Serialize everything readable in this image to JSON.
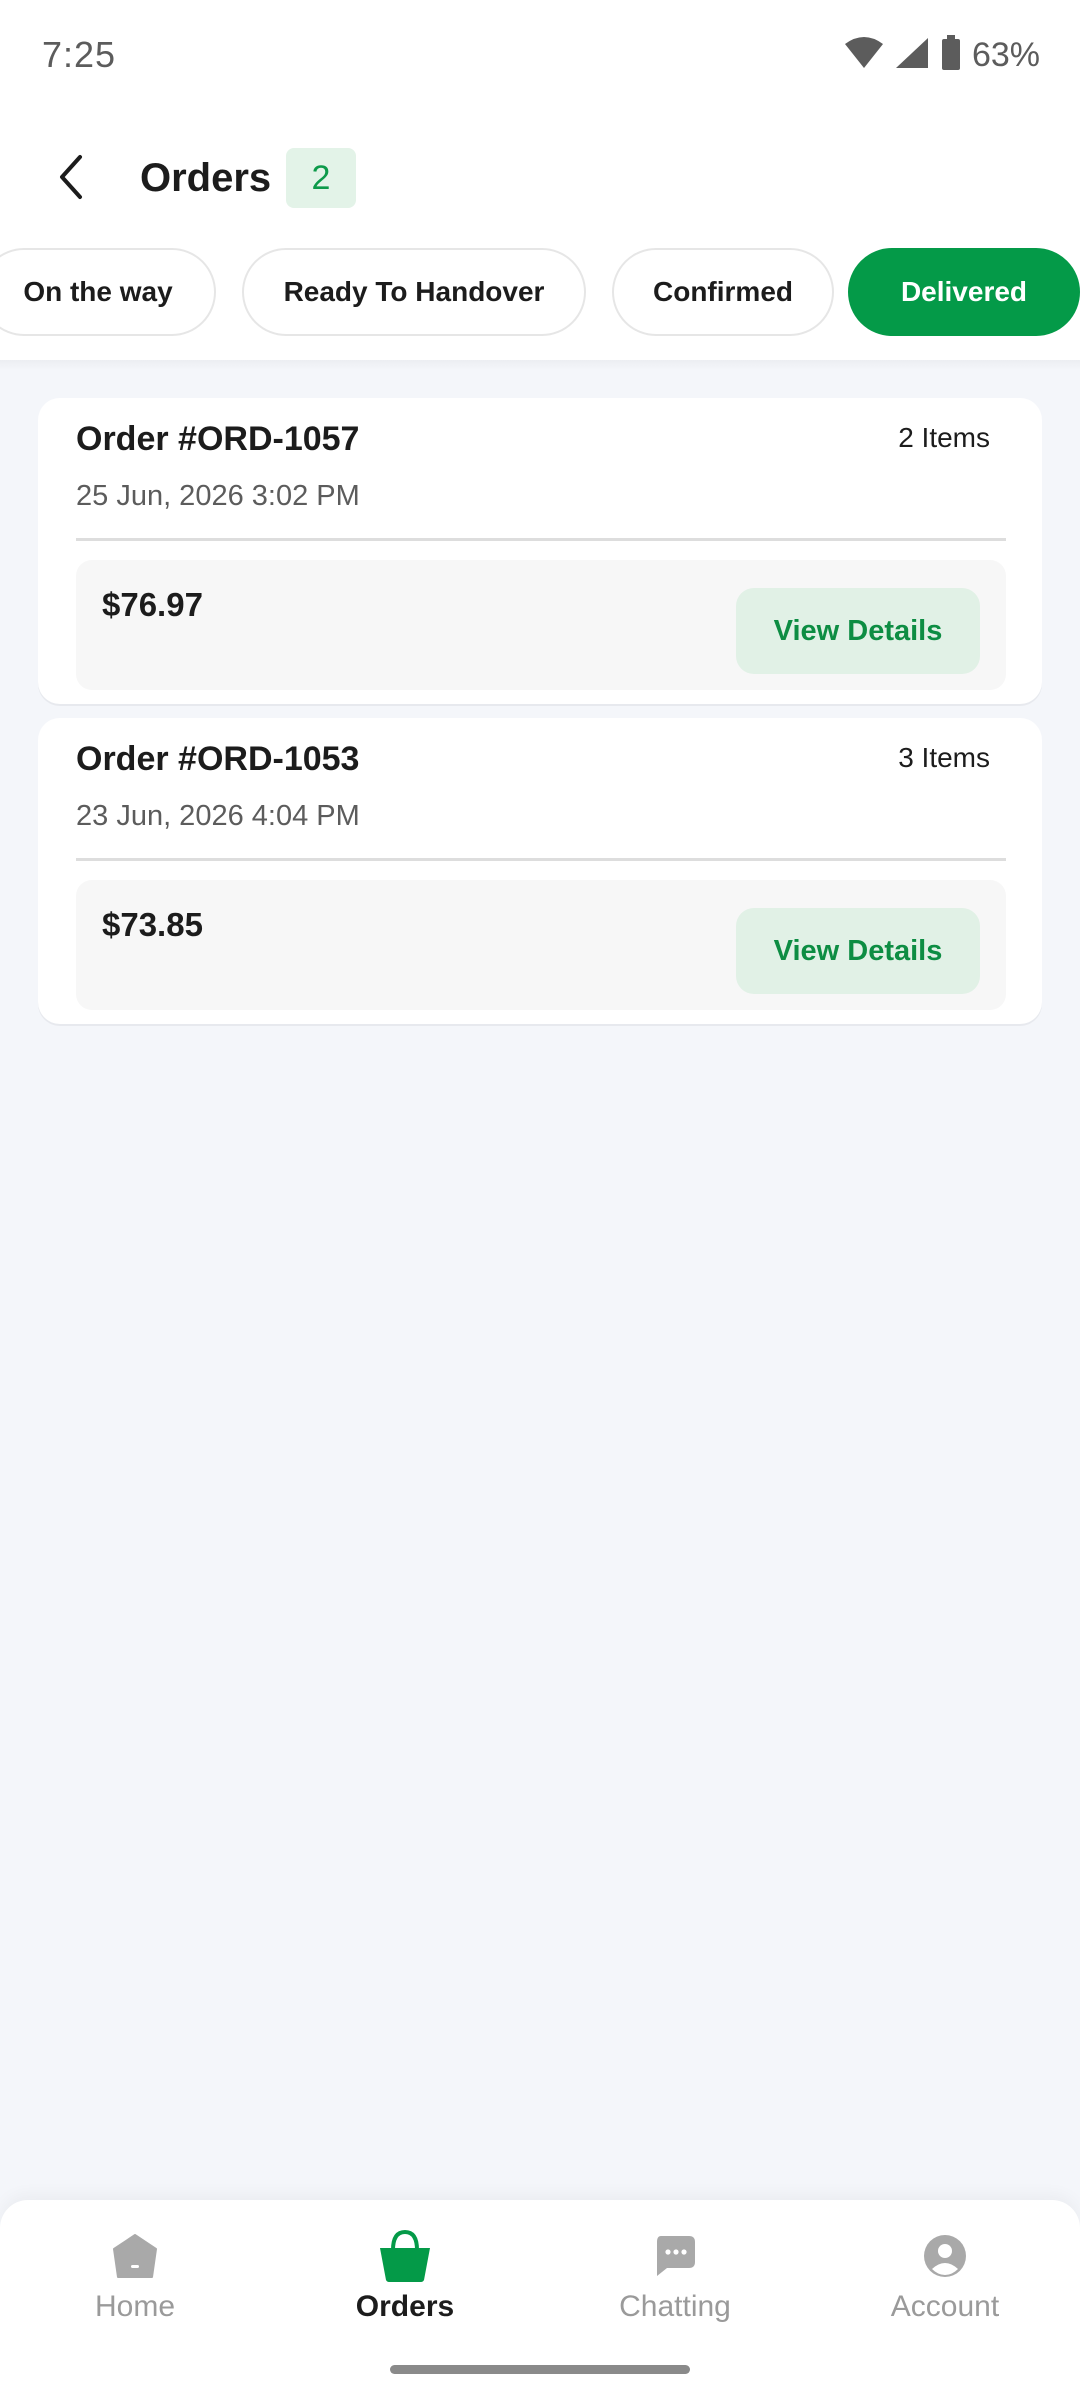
{
  "status_bar": {
    "time": "7:25",
    "battery": "63%",
    "icons": [
      "wifi-icon",
      "signal-icon",
      "battery-icon"
    ]
  },
  "header": {
    "title": "Orders",
    "count": "2",
    "back_icon": "chevron-left-icon"
  },
  "filters": [
    {
      "label": "On the way",
      "active": false
    },
    {
      "label": "Ready To Handover",
      "active": false
    },
    {
      "label": "Confirmed",
      "active": false
    },
    {
      "label": "Delivered",
      "active": true
    }
  ],
  "orders": [
    {
      "id": "Order #ORD-1057",
      "items": "2 Items",
      "date": "25 Jun, 2026 3:02 PM",
      "price": "$76.97",
      "action": "View Details"
    },
    {
      "id": "Order #ORD-1053",
      "items": "3 Items",
      "date": "23 Jun, 2026 4:04 PM",
      "price": "$73.85",
      "action": "View Details"
    }
  ],
  "bottom_nav": [
    {
      "label": "Home",
      "icon": "home-icon",
      "active": false
    },
    {
      "label": "Orders",
      "icon": "basket-icon",
      "active": true
    },
    {
      "label": "Chatting",
      "icon": "chat-icon",
      "active": false
    },
    {
      "label": "Account",
      "icon": "account-icon",
      "active": false
    }
  ],
  "colors": {
    "accent": "#049a48",
    "accent_light": "#e1f1e6",
    "background": "#f4f6fa",
    "inactive": "#9a9a9a"
  }
}
